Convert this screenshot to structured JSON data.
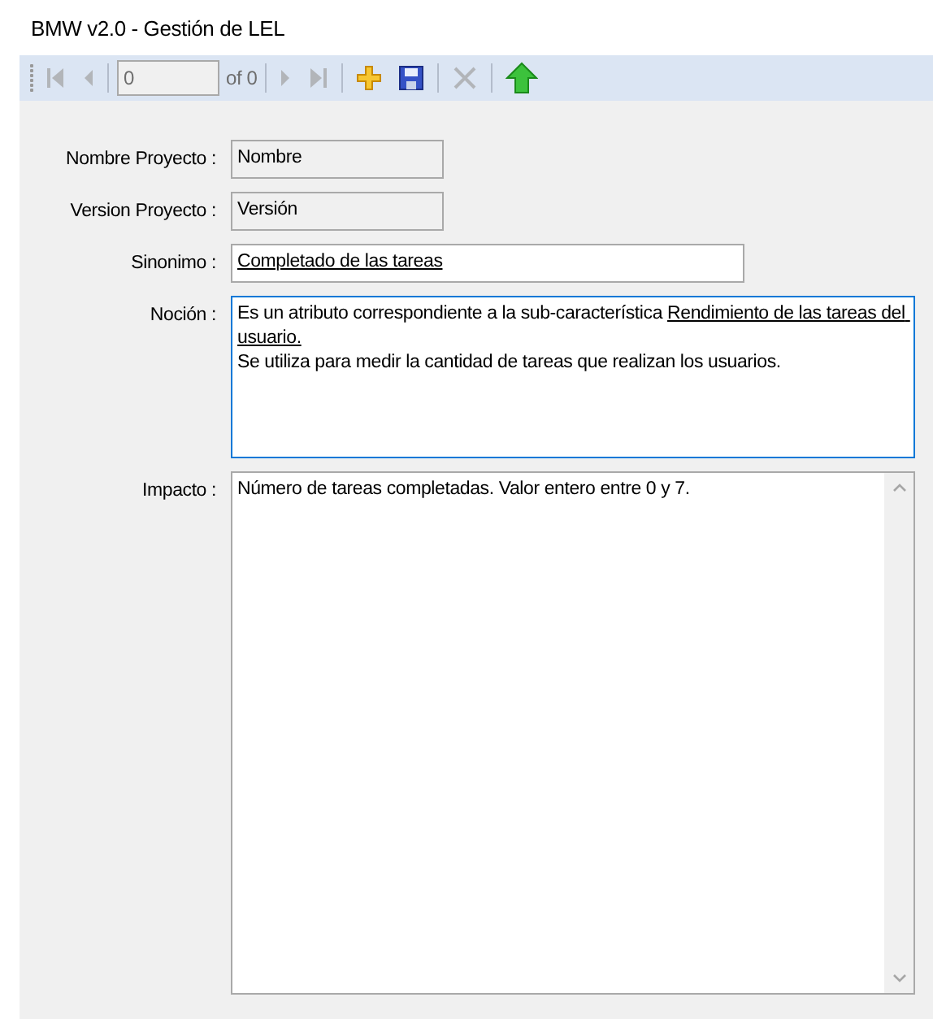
{
  "window": {
    "title": "BMW v2.0 - Gestión de LEL"
  },
  "toolbar": {
    "items": [
      {
        "kind": "first",
        "disabled": true
      },
      {
        "kind": "prev",
        "disabled": true
      },
      {
        "kind": "separator"
      },
      {
        "kind": "position",
        "value": "0"
      },
      {
        "kind": "count",
        "text": "of 0"
      },
      {
        "kind": "separator"
      },
      {
        "kind": "next",
        "disabled": true
      },
      {
        "kind": "last",
        "disabled": true
      },
      {
        "kind": "separator"
      },
      {
        "kind": "add",
        "disabled": false
      },
      {
        "kind": "save",
        "disabled": false
      },
      {
        "kind": "separator"
      },
      {
        "kind": "delete",
        "disabled": true
      },
      {
        "kind": "separator"
      },
      {
        "kind": "up",
        "disabled": false
      }
    ]
  },
  "form": {
    "fields": [
      {
        "kind": "short",
        "label": "Nombre Proyecto :",
        "readonly": true,
        "value": [
          {
            "text": "Nombre",
            "underlined": false
          }
        ]
      },
      {
        "kind": "short",
        "label": "Version Proyecto :",
        "readonly": true,
        "value": [
          {
            "text": "Versión",
            "underlined": false
          }
        ]
      },
      {
        "kind": "line",
        "label": "Sinonimo :",
        "readonly": false,
        "value": [
          {
            "text": "Completado de las tareas",
            "underlined": true
          }
        ]
      },
      {
        "kind": "memo",
        "label": "Noción :",
        "readonly": false,
        "focused": true,
        "value": [
          {
            "text": "Es un atributo correspondiente a la sub-característica ",
            "underlined": false
          },
          {
            "text": "Rendimiento de las tareas del usuario.",
            "underlined": true
          },
          {
            "text": "\nSe utiliza para medir la cantidad de tareas que realizan los usuarios.",
            "underlined": false
          }
        ]
      },
      {
        "kind": "scrollmemo",
        "label": "Impacto :",
        "readonly": false,
        "focused": false,
        "value": [
          {
            "text": "Número de tareas completadas. Valor entero entre 0 y 7.",
            "underlined": false
          }
        ]
      }
    ]
  }
}
